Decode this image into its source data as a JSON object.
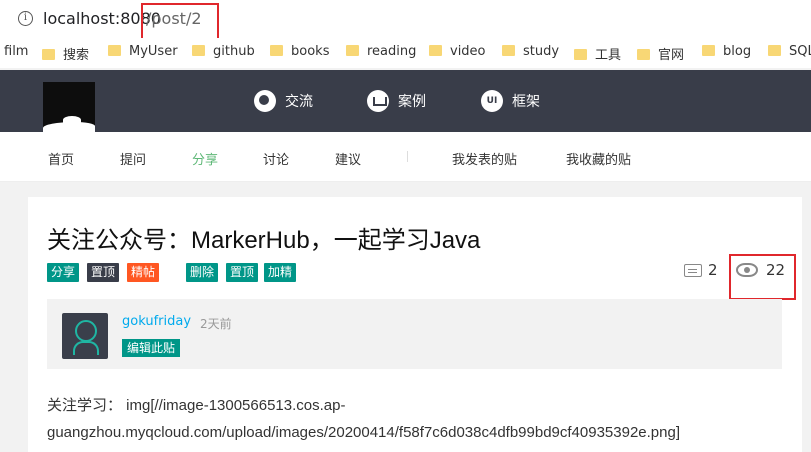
{
  "browser": {
    "url_host": "localhost:8080",
    "url_path": "/post/2",
    "bookmarks": [
      "film",
      "搜索",
      "MyUser",
      "github",
      "books",
      "reading",
      "video",
      "study",
      "工具",
      "官网",
      "blog",
      "SQL"
    ]
  },
  "header": {
    "nav": [
      {
        "label": "交流",
        "icon": "chat-icon"
      },
      {
        "label": "案例",
        "icon": "crown-icon"
      },
      {
        "label": "框架",
        "icon": "ui-icon"
      }
    ]
  },
  "subnav": {
    "items": [
      "首页",
      "提问",
      "分享",
      "讨论",
      "建议"
    ],
    "active": "分享",
    "right_items": [
      "我发表的贴",
      "我收藏的贴"
    ]
  },
  "post": {
    "title": "关注公众号：MarkerHub，一起学习Java",
    "badges": [
      "分享",
      "置顶",
      "精帖"
    ],
    "admin_badges": [
      "删除",
      "置顶",
      "加精"
    ],
    "comments": "2",
    "views": "22",
    "author": "gokufriday",
    "time": "2天前",
    "edit_label": "编辑此贴",
    "content_line1": "关注学习： img[//image-1300566513.cos.ap-",
    "content_line2": "guangzhou.myqcloud.com/upload/images/20200414/f58f7c6d038c4dfb99bd9cf40935392e.png]"
  },
  "colors": {
    "header_bg": "#393d49",
    "green": "#009688",
    "orange": "#ff5722",
    "active_nav": "#5fb878",
    "link": "#01aaed",
    "highlight_red": "#e0272c"
  }
}
